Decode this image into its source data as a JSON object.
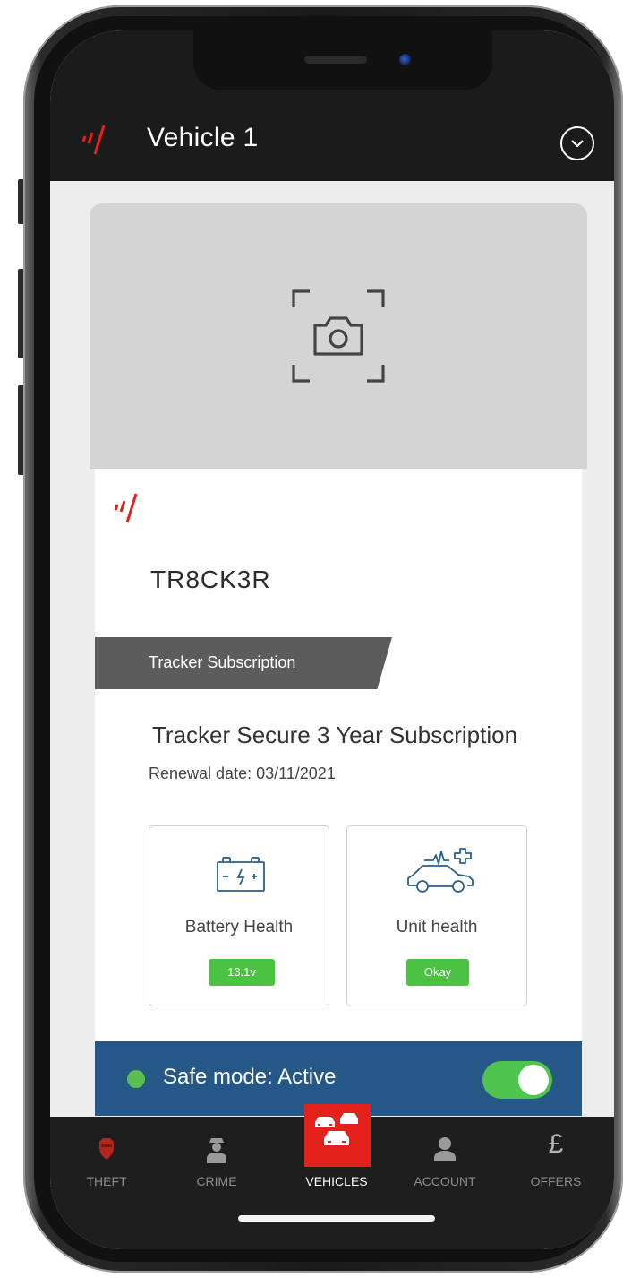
{
  "header": {
    "title": "Vehicle 1",
    "menu_icon": "chevron-down-circle-icon"
  },
  "photo": {
    "icon": "camera-add-icon"
  },
  "vehicle": {
    "plate": "TR8CK3R"
  },
  "subscription": {
    "banner_label": "Tracker Subscription",
    "plan_name": "Tracker Secure 3 Year Subscription",
    "renewal": "Renewal date: 03/11/2021"
  },
  "health": {
    "battery": {
      "label": "Battery Health",
      "value": "13.1v",
      "icon": "battery-icon"
    },
    "unit": {
      "label": "Unit health",
      "value": "Okay",
      "icon": "car-health-icon"
    }
  },
  "safe_mode": {
    "label": "Safe mode: Active",
    "enabled": true
  },
  "tabs": [
    {
      "label": "THEFT",
      "icon": "police-badge-icon",
      "active": false
    },
    {
      "label": "CRIME",
      "icon": "police-officer-icon",
      "active": false
    },
    {
      "label": "VEHICLES",
      "icon": "cars-icon",
      "active": true
    },
    {
      "label": "ACCOUNT",
      "icon": "person-icon",
      "active": false
    },
    {
      "label": "OFFERS",
      "icon": "pound-icon",
      "active": false
    }
  ],
  "colors": {
    "brand_red": "#e4221b",
    "header_bg": "#1b1b1b",
    "safe_bar": "#255886",
    "status_green": "#4cc242"
  }
}
